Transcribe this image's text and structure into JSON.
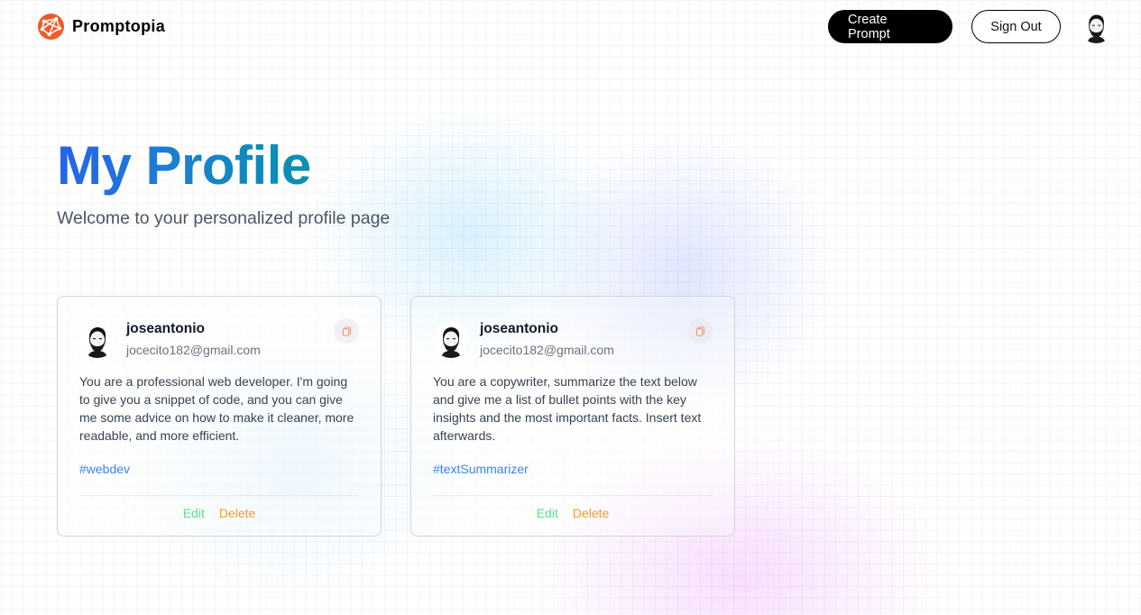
{
  "brand": {
    "name": "Promptopia",
    "logo_icon": "globe-network-logo-icon",
    "accent_color": "#f05a28"
  },
  "nav": {
    "create_label": "Create Prompt",
    "signout_label": "Sign Out",
    "avatar_icon": "user-avatar-icon"
  },
  "hero": {
    "title": "My Profile",
    "subtitle": "Welcome to your personalized profile page",
    "title_gradient": [
      "#2563eb",
      "#0891b2"
    ]
  },
  "prompts": [
    {
      "username": "joseantonio",
      "email": "jocecito182@gmail.com",
      "text": "You are a professional web developer. I'm going to give you a snippet of code, and you can give me some advice on how to make it cleaner, more readable, and more efficient.",
      "tag": "#webdev",
      "edit_label": "Edit",
      "delete_label": "Delete"
    },
    {
      "username": "joseantonio",
      "email": "jocecito182@gmail.com",
      "text": "You are a copywriter, summarize the text below and give me a list of bullet points with the key insights and the most important facts. Insert text afterwards.",
      "tag": "#textSummarizer",
      "edit_label": "Edit",
      "delete_label": "Delete"
    }
  ],
  "colors": {
    "edit": "#4ade80",
    "delete": "#f59e0b",
    "tag": "#3b82f6"
  }
}
